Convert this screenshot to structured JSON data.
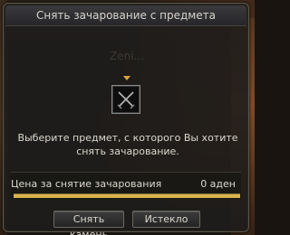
{
  "window": {
    "title": "Снять зачарование с предмета"
  },
  "background": {
    "ghost_text": "Zeni..."
  },
  "item_slot": {
    "icon": "crossed-swords-icon"
  },
  "instruction_text": "Выберите предмет, с которого Вы хотите снять зачарование.",
  "price": {
    "label": "Цена за снятие зачарования",
    "value": "0 аден",
    "progress_fraction": 1.0
  },
  "buttons": {
    "remove_stone_label": "Снять камень",
    "expired_label": "Истекло"
  },
  "colors": {
    "accent": "#d9b44a",
    "indicator": "#d9a33a",
    "text": "#dcd9d0"
  }
}
